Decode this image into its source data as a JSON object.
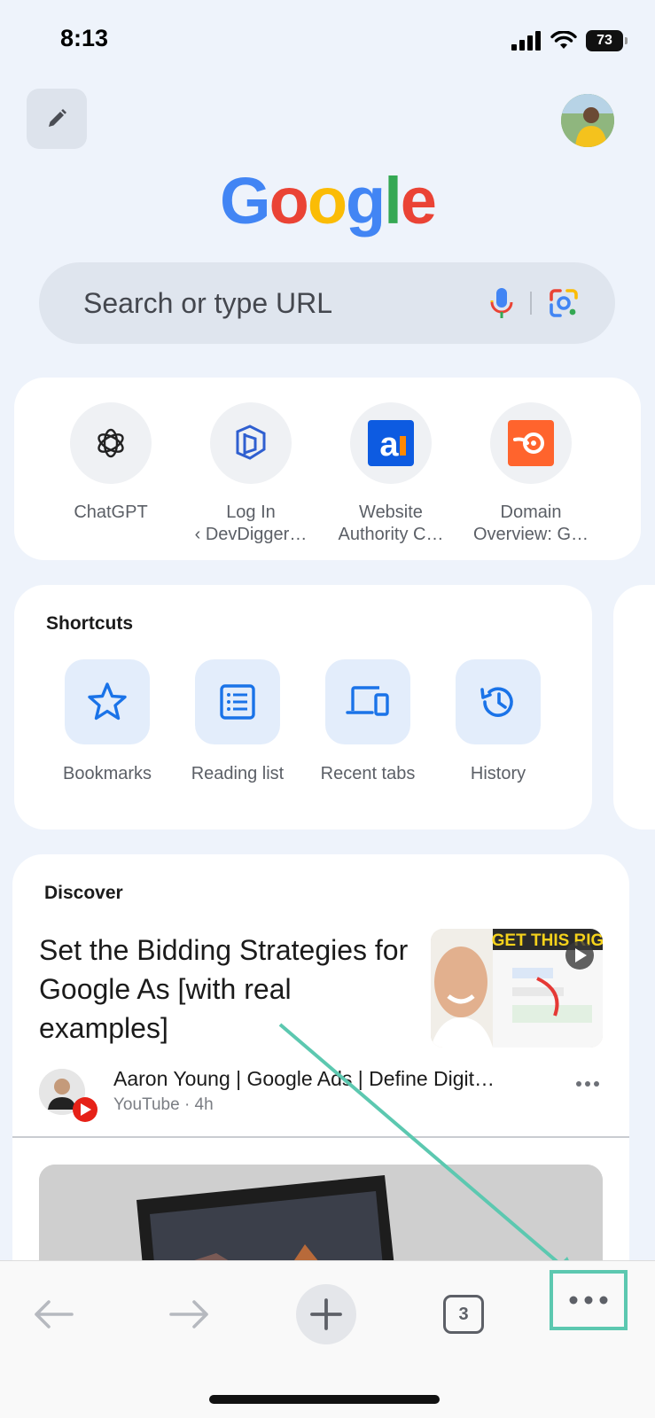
{
  "status_bar": {
    "time": "8:13",
    "battery": "73"
  },
  "header": {
    "edit_icon": "pencil-icon",
    "avatar": "profile-avatar"
  },
  "logo": {
    "letters": [
      "G",
      "o",
      "o",
      "g",
      "l",
      "e"
    ],
    "colors": [
      "#4285F4",
      "#EA4335",
      "#FBBC05",
      "#4285F4",
      "#34A853",
      "#EA4335"
    ]
  },
  "search": {
    "placeholder": "Search or type URL",
    "mic_icon": "microphone-icon",
    "lens_icon": "lens-icon"
  },
  "most_visited": [
    {
      "label": "ChatGPT",
      "icon": "chatgpt-icon"
    },
    {
      "label": "Log In\n‹ DevDigger…",
      "line1": "Log In",
      "line2": "‹ DevDigger…",
      "icon": "devdigger-icon"
    },
    {
      "label": "Website Authority C…",
      "line1": "Website",
      "line2": "Authority C…",
      "icon": "ahrefs-icon"
    },
    {
      "label": "Domain Overview: G…",
      "line1": "Domain",
      "line2": "Overview: G…",
      "icon": "semrush-icon"
    }
  ],
  "shortcuts": {
    "title": "Shortcuts",
    "items": [
      {
        "label": "Bookmarks",
        "icon": "star-icon"
      },
      {
        "label": "Reading list",
        "icon": "reading-list-icon"
      },
      {
        "label": "Recent tabs",
        "icon": "devices-icon"
      },
      {
        "label": "History",
        "icon": "history-icon"
      }
    ]
  },
  "discover": {
    "title": "Discover",
    "article": {
      "headline": "Set the Bidding Strategies for Google As [with real examples]",
      "thumb_text": "GET THIS RIG",
      "author": "Aaron Young  | Google Ads | Define Digit…",
      "source": "YouTube",
      "age": "4h",
      "meta": "YouTube · 4h"
    }
  },
  "toolbar": {
    "tab_count": "3"
  },
  "colors": {
    "accent": "#1a73e8",
    "highlight": "#5cc8b0",
    "background": "#eef3fb"
  }
}
